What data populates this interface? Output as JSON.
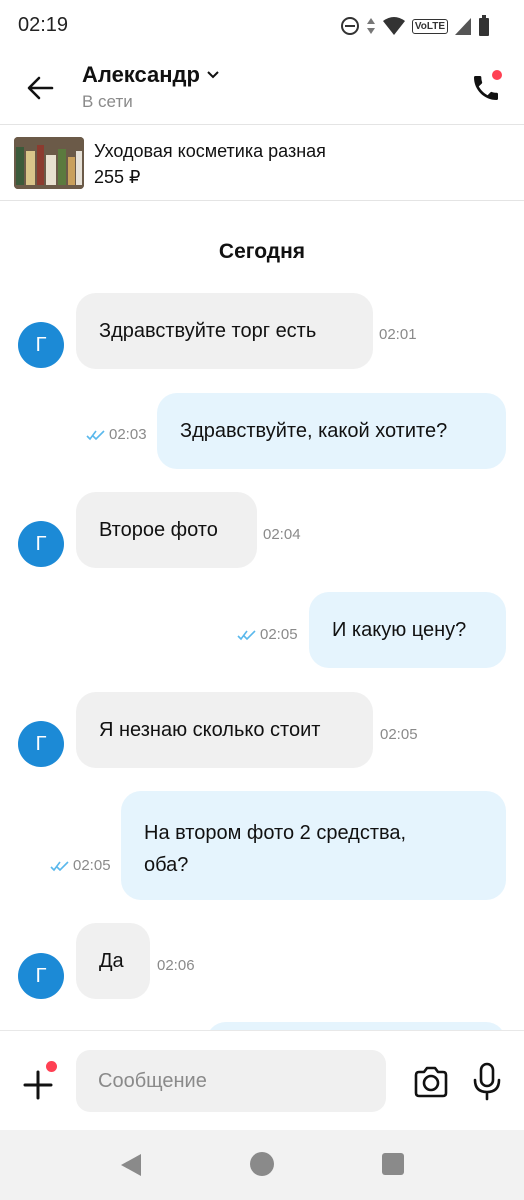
{
  "status_bar": {
    "time": "02:19",
    "network_badge": "VoLTE"
  },
  "header": {
    "contact_name": "Александр",
    "contact_status": "В сети"
  },
  "product": {
    "title": "Уходовая косметика разная",
    "price": "255 ₽"
  },
  "chat": {
    "date_separator": "Сегодня",
    "avatar_letter": "Г",
    "messages": [
      {
        "direction": "in",
        "text": "Здравствуйте торг есть",
        "time": "02:01"
      },
      {
        "direction": "out",
        "text": "Здравствуйте, какой хотите?",
        "time": "02:03",
        "read": true
      },
      {
        "direction": "in",
        "text": "Второе фото",
        "time": "02:04"
      },
      {
        "direction": "out",
        "text": "И какую цену?",
        "time": "02:05",
        "read": true
      },
      {
        "direction": "in",
        "text": "Я незнаю сколько стоит",
        "time": "02:05"
      },
      {
        "direction": "out",
        "text": "На втором фото 2 средства, оба?",
        "time": "02:05",
        "read": true
      },
      {
        "direction": "in",
        "text": "Да",
        "time": "02:06"
      }
    ]
  },
  "composer": {
    "placeholder": "Сообщение"
  },
  "colors": {
    "accent": "#1c8ad6",
    "notification": "#ff4053",
    "incoming_bubble": "#f0f0f0",
    "outgoing_bubble": "#e5f4fd",
    "read_check": "#5ab8ec"
  }
}
